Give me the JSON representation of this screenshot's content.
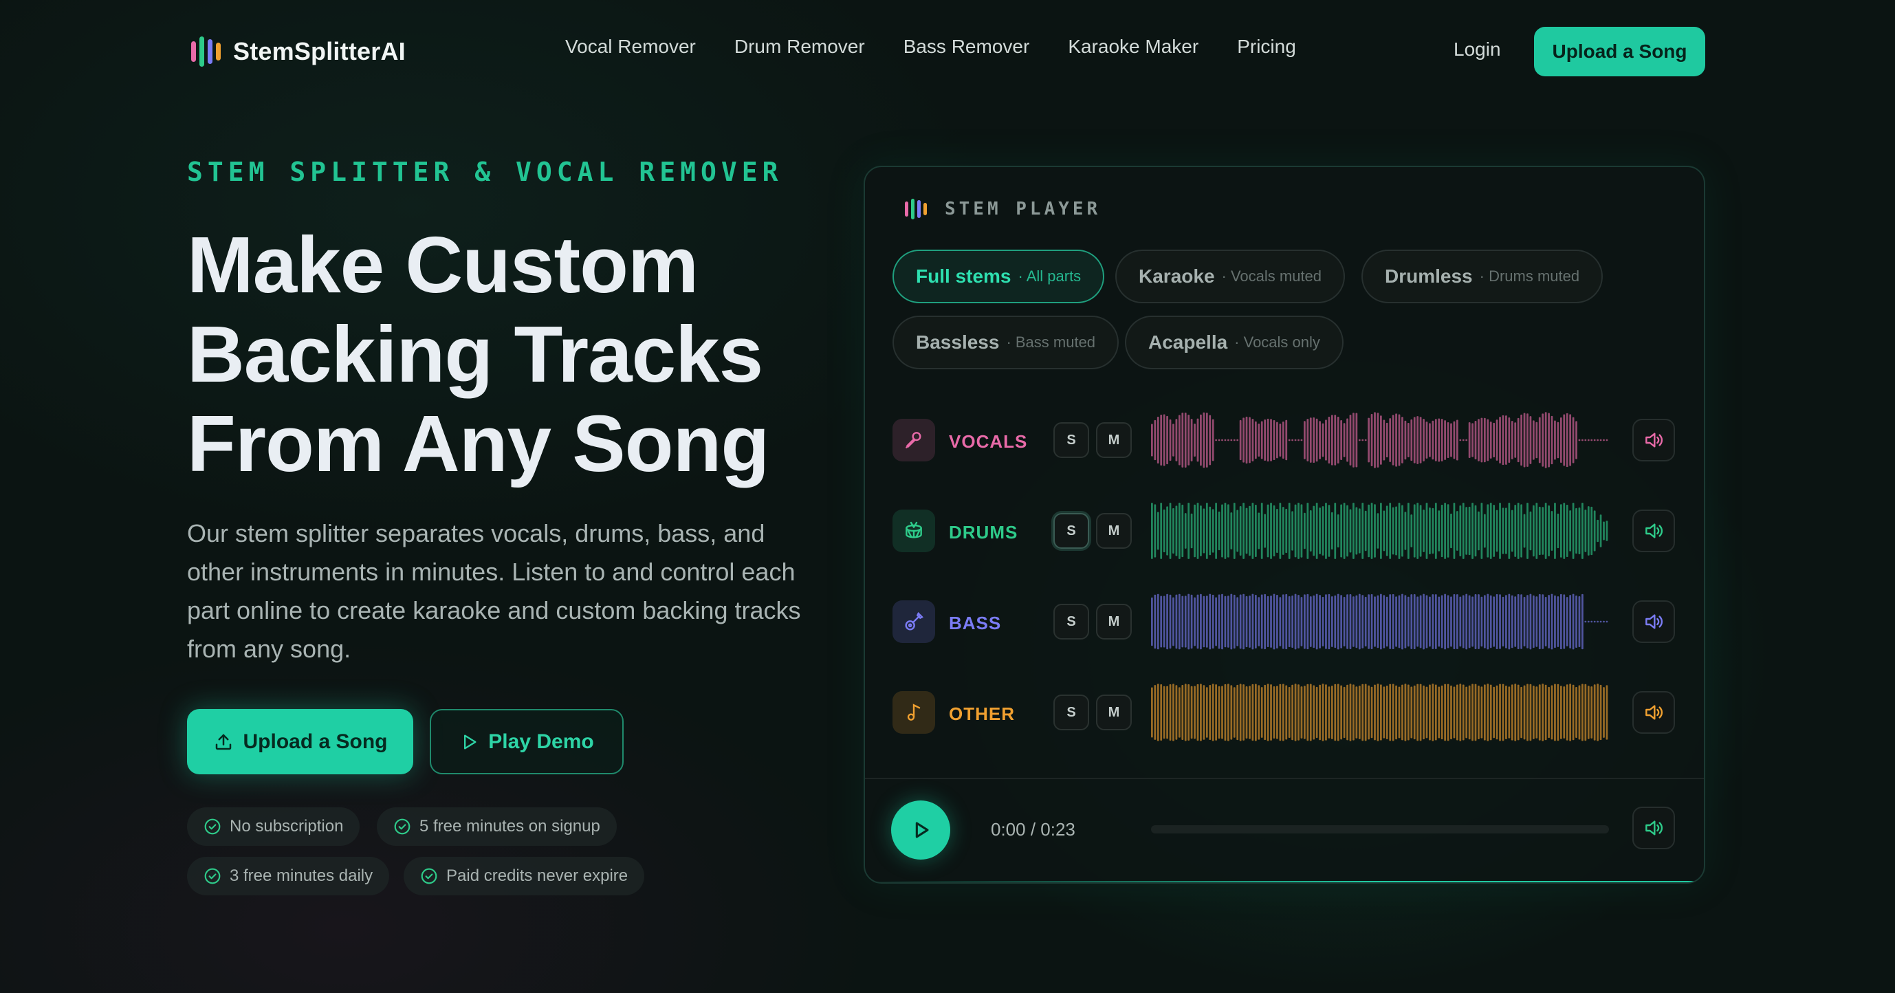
{
  "nav": {
    "brand": "StemSplitterAI",
    "links": [
      "Vocal Remover",
      "Drum Remover",
      "Bass Remover",
      "Karaoke Maker",
      "Pricing"
    ],
    "login": "Login",
    "cta": "Upload a Song"
  },
  "hero": {
    "eyebrow": "STEM SPLITTER & VOCAL REMOVER",
    "headline_lines": [
      "Make Custom",
      "Backing Tracks",
      "From Any Song"
    ],
    "description": "Our stem splitter separates vocals, drums, bass, and other instruments in minutes. Listen to and control each part online to create karaoke and custom backing tracks from any song.",
    "primary_button": "Upload a Song",
    "secondary_button": "Play Demo",
    "features": [
      "No subscription",
      "5 free minutes on signup",
      "3 free minutes daily",
      "Paid credits never expire"
    ]
  },
  "player": {
    "title": "STEM PLAYER",
    "modes": [
      {
        "label": "Full stems",
        "sub": "· All parts",
        "active": true
      },
      {
        "label": "Karaoke",
        "sub": "· Vocals muted",
        "active": false
      },
      {
        "label": "Drumless",
        "sub": "· Drums muted",
        "active": false
      },
      {
        "label": "Bassless",
        "sub": "· Bass muted",
        "active": false
      },
      {
        "label": "Acapella",
        "sub": "· Vocals only",
        "active": false
      }
    ],
    "tracks": [
      {
        "name": "VOCALS",
        "color": "#e86aa8",
        "solo": "S",
        "mute": "M",
        "icon": "microphone-icon"
      },
      {
        "name": "DRUMS",
        "color": "#2ecb8a",
        "solo": "S",
        "mute": "M",
        "icon": "drum-icon"
      },
      {
        "name": "BASS",
        "color": "#7b7cf5",
        "solo": "S",
        "mute": "M",
        "icon": "guitar-icon"
      },
      {
        "name": "OTHER",
        "color": "#f0a030",
        "solo": "S",
        "mute": "M",
        "icon": "music-note-icon"
      }
    ],
    "time": "0:00 / 0:23",
    "progress": 0
  },
  "colors": {
    "accent": "#1fcfa4",
    "vocals": "#e86aa8",
    "drums": "#2ecb8a",
    "bass": "#7b7cf5",
    "other": "#f0a030"
  }
}
